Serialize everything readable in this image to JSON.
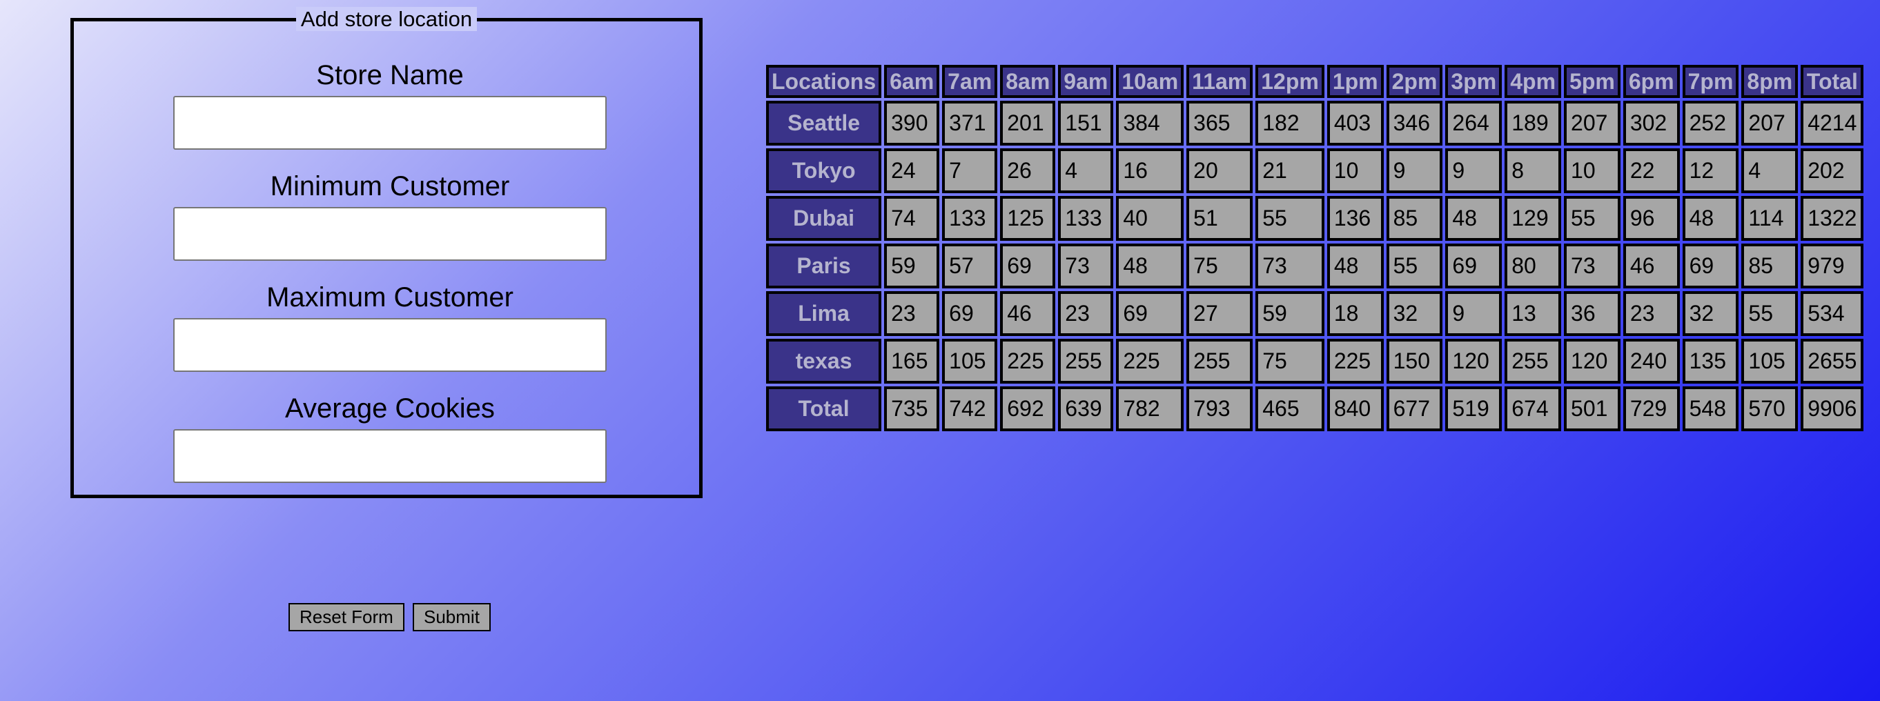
{
  "form": {
    "legend": "Add store location",
    "fields": [
      {
        "label": "Store Name",
        "value": ""
      },
      {
        "label": "Minimum Customer",
        "value": ""
      },
      {
        "label": "Maximum Customer",
        "value": ""
      },
      {
        "label": "Average Cookies",
        "value": ""
      }
    ],
    "reset_label": "Reset Form",
    "submit_label": "Submit"
  },
  "table": {
    "headers": [
      "Locations",
      "6am",
      "7am",
      "8am",
      "9am",
      "10am",
      "11am",
      "12pm",
      "1pm",
      "2pm",
      "3pm",
      "4pm",
      "5pm",
      "6pm",
      "7pm",
      "8pm",
      "Total"
    ],
    "rows": [
      {
        "location": "Seattle",
        "values": [
          "390",
          "371",
          "201",
          "151",
          "384",
          "365",
          "182",
          "403",
          "346",
          "264",
          "189",
          "207",
          "302",
          "252",
          "207",
          "4214"
        ]
      },
      {
        "location": "Tokyo",
        "values": [
          "24",
          "7",
          "26",
          "4",
          "16",
          "20",
          "21",
          "10",
          "9",
          "9",
          "8",
          "10",
          "22",
          "12",
          "4",
          "202"
        ]
      },
      {
        "location": "Dubai",
        "values": [
          "74",
          "133",
          "125",
          "133",
          "40",
          "51",
          "55",
          "136",
          "85",
          "48",
          "129",
          "55",
          "96",
          "48",
          "114",
          "1322"
        ]
      },
      {
        "location": "Paris",
        "values": [
          "59",
          "57",
          "69",
          "73",
          "48",
          "75",
          "73",
          "48",
          "55",
          "69",
          "80",
          "73",
          "46",
          "69",
          "85",
          "979"
        ]
      },
      {
        "location": "Lima",
        "values": [
          "23",
          "69",
          "46",
          "23",
          "69",
          "27",
          "59",
          "18",
          "32",
          "9",
          "13",
          "36",
          "23",
          "32",
          "55",
          "534"
        ]
      },
      {
        "location": "texas",
        "values": [
          "165",
          "105",
          "225",
          "255",
          "225",
          "255",
          "75",
          "225",
          "150",
          "120",
          "255",
          "120",
          "240",
          "135",
          "105",
          "2655"
        ]
      }
    ],
    "totals": {
      "label": "Total",
      "values": [
        "735",
        "742",
        "692",
        "639",
        "782",
        "793",
        "465",
        "840",
        "677",
        "519",
        "674",
        "501",
        "729",
        "548",
        "570",
        "9906"
      ]
    }
  },
  "colors": {
    "header_bg": "#3a3389",
    "header_text": "#b5b4ce",
    "cell_bg": "#a6a6a6",
    "button_bg": "#a6a6a6"
  }
}
